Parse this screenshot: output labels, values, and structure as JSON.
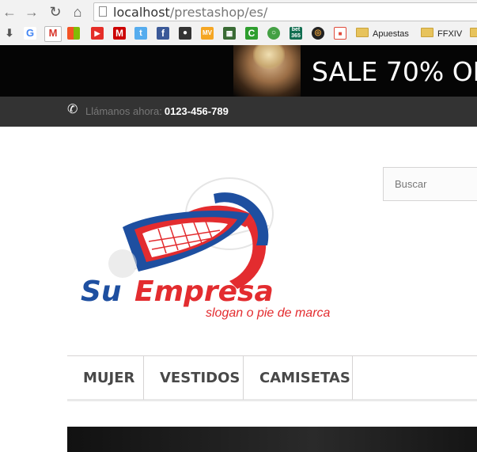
{
  "browser": {
    "url_host": "localhost",
    "url_path": "/prestashop/es/",
    "bookmark_folders": [
      "Apuestas",
      "FFXIV"
    ],
    "bookmark_icons": [
      {
        "name": "g-icon",
        "color": "#ffffff"
      },
      {
        "name": "gmail-icon",
        "color": "#d9352a"
      },
      {
        "name": "windows-icon",
        "color": "#f35325"
      },
      {
        "name": "youtube-icon",
        "color": "#e52d27"
      },
      {
        "name": "marca-icon",
        "color": "#cc0000"
      },
      {
        "name": "twitter-icon",
        "color": "#55acee"
      },
      {
        "name": "facebook-icon",
        "color": "#3b5998"
      },
      {
        "name": "camera-icon",
        "color": "#333333"
      },
      {
        "name": "mv-icon",
        "color": "#f5a623"
      },
      {
        "name": "grid-icon",
        "color": "#3a6b35"
      },
      {
        "name": "c-icon",
        "color": "#2e9e2e"
      },
      {
        "name": "circle-icon",
        "color": "#44a044"
      },
      {
        "name": "bet365-icon",
        "color": "#126e51"
      },
      {
        "name": "round-icon",
        "color": "#222222"
      },
      {
        "name": "pdf-icon",
        "color": "#e04a3a"
      }
    ]
  },
  "banner": {
    "sale_text": "SALE 70% OI"
  },
  "topbar": {
    "call_label": "Llámanos ahora:",
    "phone_number": "0123-456-789"
  },
  "search": {
    "placeholder": "Buscar"
  },
  "logo": {
    "brand_su": "Su",
    "brand_empresa": "Empresa",
    "slogan": "slogan o pie de marca"
  },
  "menu": {
    "items": [
      "MUJER",
      "VESTIDOS",
      "CAMISETAS"
    ]
  }
}
